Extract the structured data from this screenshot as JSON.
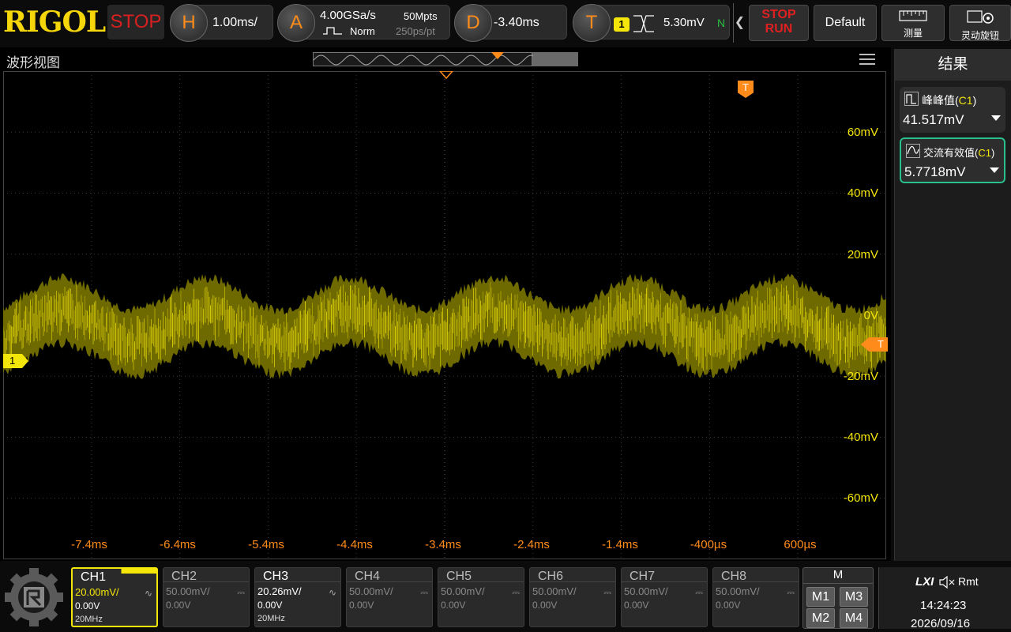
{
  "brand": {
    "logo": "RIGOL",
    "status": "STOP"
  },
  "horizontal": {
    "key": "H",
    "timebase": "1.00ms/"
  },
  "acquire": {
    "key": "A",
    "sample_rate": "4.00GSa/s",
    "mode": "Norm",
    "memory_depth": "50Mpts",
    "sample_interval": "250ps/pt"
  },
  "delay": {
    "key": "D",
    "offset": "-3.40ms"
  },
  "trigger": {
    "key": "T",
    "source": "1",
    "level": "5.30mV",
    "sweep": "N"
  },
  "buttons": {
    "stop_label": "STOP",
    "run_label": "RUN",
    "default_label": "Default",
    "measure_label": "测量",
    "knob_label": "灵动旋钮"
  },
  "waveform": {
    "title": "波形视图",
    "channel_marker": "1",
    "trigger_marker": "T",
    "y_labels": [
      "60mV",
      "40mV",
      "20mV",
      "0V",
      "-20mV",
      "-40mV",
      "-60mV"
    ],
    "x_labels": [
      "-7.4ms",
      "-6.4ms",
      "-5.4ms",
      "-4.4ms",
      "-3.4ms",
      "-2.4ms",
      "-1.4ms",
      "-400µs",
      "600µs"
    ],
    "trace_color": "#f5e60a"
  },
  "results": {
    "title": "结果",
    "items": [
      {
        "name": "峰峰值",
        "source": "C1",
        "value": "41.517mV"
      },
      {
        "name": "交流有效值",
        "source": "C1",
        "value": "5.7718mV"
      }
    ]
  },
  "channels": [
    {
      "name": "CH1",
      "scale": "20.00mV/",
      "offset": "0.00V",
      "bw": "20MHz"
    },
    {
      "name": "CH2",
      "scale": "50.00mV/",
      "offset": "0.00V",
      "bw": ""
    },
    {
      "name": "CH3",
      "scale": "20.26mV/",
      "offset": "0.00V",
      "bw": "20MHz"
    },
    {
      "name": "CH4",
      "scale": "50.00mV/",
      "offset": "0.00V",
      "bw": ""
    },
    {
      "name": "CH5",
      "scale": "50.00mV/",
      "offset": "0.00V",
      "bw": ""
    },
    {
      "name": "CH6",
      "scale": "50.00mV/",
      "offset": "0.00V",
      "bw": ""
    },
    {
      "name": "CH7",
      "scale": "50.00mV/",
      "offset": "0.00V",
      "bw": ""
    },
    {
      "name": "CH8",
      "scale": "50.00mV/",
      "offset": "0.00V",
      "bw": ""
    }
  ],
  "math": {
    "title": "M",
    "buttons": [
      "M1",
      "M3",
      "M2",
      "M4"
    ]
  },
  "system": {
    "lxi": "LXI",
    "remote": "Rmt",
    "time": "14:24:23",
    "date": "2026/09/16"
  }
}
